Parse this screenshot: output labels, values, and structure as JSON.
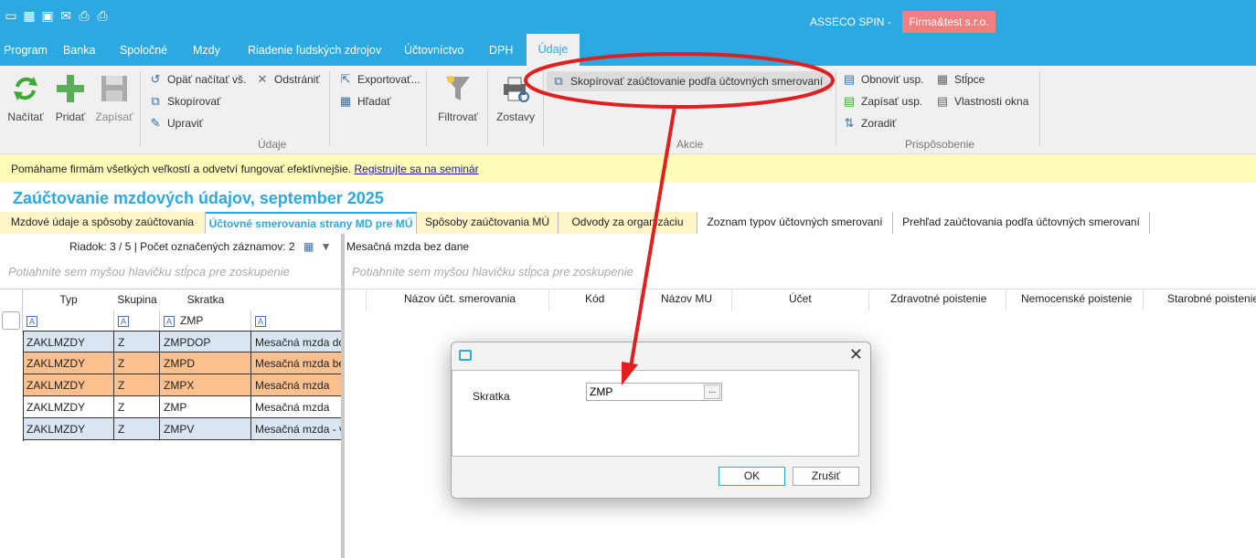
{
  "app": {
    "name": "ASSECO SPIN",
    "separator": "-",
    "company": "Firma&test s.r.o."
  },
  "menu": {
    "items": [
      "Program",
      "Banka",
      "Spoločné",
      "Mzdy",
      "Riadenie ľudských zdrojov",
      "Účtovníctvo",
      "DPH",
      "Údaje"
    ],
    "active": "Údaje"
  },
  "ribbon": {
    "nacitat": "Načítať",
    "pridat": "Pridať",
    "zapisat": "Zapísať",
    "opat_nacitat": "Opäť načítať vš.",
    "odstranit": "Odstrániť",
    "skopirovat": "Skopírovať",
    "upravit": "Upraviť",
    "group_udaje": "Údaje",
    "exportovat": "Exportovať...",
    "hladat": "Hľadať",
    "filtrovat": "Filtrovať",
    "zostavy": "Zostavy",
    "copy_posting": "Skopírovať zaúčtovanie podľa účtovných smerovaní",
    "group_akcie": "Akcie",
    "obnovit_usp": "Obnoviť usp.",
    "zapisat_usp": "Zapísať usp.",
    "zoradit": "Zoradiť",
    "stlpce": "Stĺpce",
    "vlastnosti_okna": "Vlastnosti okna",
    "group_prisposobenie": "Prispôsobenie"
  },
  "banner": {
    "text": "Pomáhame firmám všetkých veľkostí a odvetví fungovať efektívnejšie.",
    "link": "Registrujte sa na seminár"
  },
  "page_title": "Zaúčtovanie mzdových údajov, september 2025",
  "tabs": [
    "Mzdové údaje a spôsoby zaúčtovania",
    "Účtovné smerovania strany MD pre MÚ",
    "Spôsoby zaúčtovania MÚ",
    "Odvody za organizáciu",
    "Zoznam typov účtovných smerovaní",
    "Prehľad zaúčtovania podľa účtovných smerovaní"
  ],
  "left": {
    "info": "Riadok: 3 / 5 | Počet označených záznamov: 2",
    "group_hint": "Potiahnite sem myšou hlavičku stĺpca pre zoskupenie",
    "columns": [
      "Typ",
      "Skupina",
      "Skratka"
    ],
    "filter_skratka": "ZMP",
    "filter_icon": "A",
    "rows": [
      {
        "typ": "ZAKLMZDY",
        "skupina": "Z",
        "skratka": "ZMPDOP",
        "nazov": "Mesačná mzda do"
      },
      {
        "typ": "ZAKLMZDY",
        "skupina": "Z",
        "skratka": "ZMPD",
        "nazov": "Mesačná mzda be"
      },
      {
        "typ": "ZAKLMZDY",
        "skupina": "Z",
        "skratka": "ZMPX",
        "nazov": "Mesačná mzda"
      },
      {
        "typ": "ZAKLMZDY",
        "skupina": "Z",
        "skratka": "ZMP",
        "nazov": "Mesačná mzda"
      },
      {
        "typ": "ZAKLMZDY",
        "skupina": "Z",
        "skratka": "ZMPV",
        "nazov": "Mesačná mzda - v"
      }
    ]
  },
  "right": {
    "title": "Mesačná mzda bez dane",
    "group_hint": "Potiahnite sem myšou hlavičku stĺpca pre zoskupenie",
    "columns": [
      "Názov účt. smerovania",
      "Kód",
      "Názov MU",
      "Účet",
      "Zdravotné poistenie",
      "Nemocenské poistenie",
      "Starobné poistenie"
    ]
  },
  "dialog": {
    "label": "Skratka",
    "value": "ZMP",
    "dots": "...",
    "ok": "OK",
    "cancel": "Zrušiť"
  },
  "colors": {
    "accent": "#2ca9e1",
    "company_badge": "#f08080",
    "banner_bg": "#fffbb8",
    "row_blue": "#d9e6f2",
    "row_orange": "#fbc08d",
    "annotation_red": "#e02020"
  }
}
